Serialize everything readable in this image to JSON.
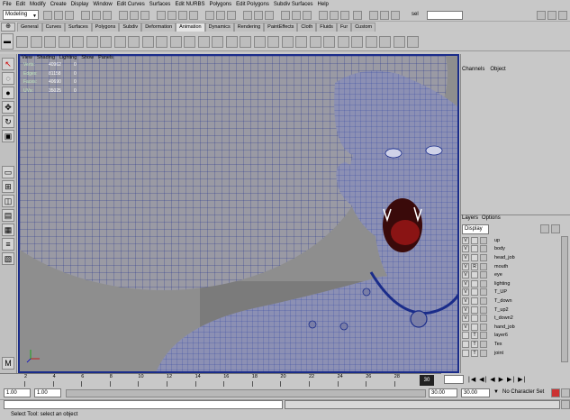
{
  "menu": [
    "File",
    "Edit",
    "Modify",
    "Create",
    "Display",
    "Window",
    "Edit Curves",
    "Surfaces",
    "Edit NURBS",
    "Polygons",
    "Edit Polygons",
    "Subdiv Surfaces",
    "Help"
  ],
  "status": {
    "mode": "Modeling",
    "sel_label": "sel"
  },
  "shelf_tabs": [
    "General",
    "Curves",
    "Surfaces",
    "Polygons",
    "Subdiv",
    "Deformation",
    "Animation",
    "Dynamics",
    "Rendering",
    "PaintEffects",
    "Cloth",
    "Fluids",
    "Fur",
    "Custom"
  ],
  "active_shelf_tab": "Animation",
  "viewport": {
    "menu": [
      "View",
      "Shading",
      "Lighting",
      "Show",
      "Panels"
    ],
    "hud": [
      {
        "k": "Verts:",
        "v1": "40962",
        "v2": "0"
      },
      {
        "k": "Edges:",
        "v1": "81158",
        "v2": "0"
      },
      {
        "k": "Faces:",
        "v1": "40690",
        "v2": "0"
      },
      {
        "k": "UVs:",
        "v1": "35025",
        "v2": "0"
      }
    ]
  },
  "channel_box": {
    "tabs": [
      "Channels",
      "Object"
    ]
  },
  "layer_editor": {
    "tabs": [
      "Layers",
      "Options"
    ],
    "display": "Display",
    "layers": [
      {
        "v": "V",
        "r": "",
        "name": "up"
      },
      {
        "v": "V",
        "r": "",
        "name": "body"
      },
      {
        "v": "V",
        "r": "",
        "name": "head_job"
      },
      {
        "v": "V",
        "r": "R",
        "name": "mouth"
      },
      {
        "v": "V",
        "r": "",
        "name": "eye"
      },
      {
        "v": "V",
        "r": "",
        "name": "lighting"
      },
      {
        "v": "V",
        "r": "",
        "name": "T_UP"
      },
      {
        "v": "V",
        "r": "",
        "name": "T_down"
      },
      {
        "v": "V",
        "r": "",
        "name": "T_up2"
      },
      {
        "v": "V",
        "r": "",
        "name": "t_down2"
      },
      {
        "v": "V",
        "r": "",
        "name": "hand_job"
      },
      {
        "v": "",
        "r": "T",
        "name": "layer6"
      },
      {
        "v": "",
        "r": "T",
        "name": "Tex"
      },
      {
        "v": "",
        "r": "T",
        "name": "joint"
      }
    ]
  },
  "time_slider": {
    "ticks": [
      "2",
      "4",
      "6",
      "8",
      "10",
      "12",
      "14",
      "16",
      "18",
      "20",
      "22",
      "24",
      "26",
      "28"
    ],
    "current": "30"
  },
  "range": {
    "start": "1.00",
    "start2": "1.00",
    "end": "30.00",
    "end2": "30.00",
    "character": "No Character Set"
  },
  "help": "Select Tool: select an object",
  "colors": {
    "wire": "#1a2c8a",
    "bg": "#8e8e8e"
  }
}
